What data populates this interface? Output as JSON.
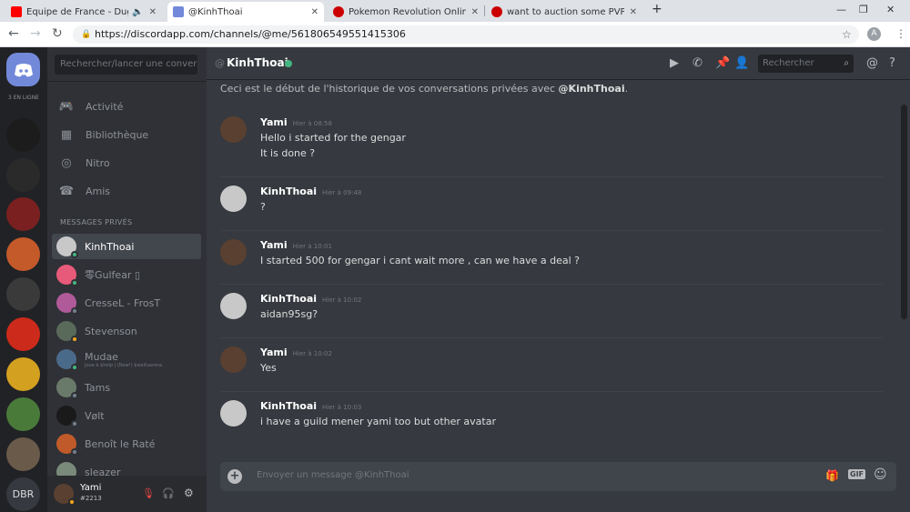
{
  "browser": {
    "tabs": [
      {
        "title": "Equipe de France - Dugarry",
        "fav_color": "#ff0000"
      },
      {
        "title": "@KinhThoai",
        "fav_color": "#7289da"
      },
      {
        "title": "Pokemon Revolution Online",
        "fav_color": "#cc0000"
      },
      {
        "title": "want to auction some PVP POKEM",
        "fav_color": "#cc0000"
      }
    ],
    "url": "https://discordapp.com/channels/@me/561806549551415306",
    "profile_initial": "A"
  },
  "guilds": {
    "online_label": "3 EN LIGNE",
    "bottom_label": "DBR",
    "icon_colors": [
      "#1c1c1c",
      "#2a2a2a",
      "#7a2020",
      "#c45a2a",
      "#3a3a3a",
      "#cc2a1a",
      "#d4a020",
      "#4a7a3a",
      "#6a5a4a"
    ]
  },
  "sidebar": {
    "search_placeholder": "Rechercher/lancer une conversati",
    "nav": [
      {
        "label": "Activité",
        "icon": "gamepad-icon"
      },
      {
        "label": "Bibliothèque",
        "icon": "library-icon"
      },
      {
        "label": "Nitro",
        "icon": "nitro-icon"
      },
      {
        "label": "Amis",
        "icon": "friends-icon"
      }
    ],
    "dm_header": "MESSAGES PRIVÉS",
    "dms": [
      {
        "name": "KinhThoai",
        "sub": "",
        "status": "#43b581",
        "avatar": "#c8c8c8"
      },
      {
        "name": "零Gulfear ▯",
        "sub": "",
        "status": "#43b581",
        "avatar": "#e85a7a"
      },
      {
        "name": "CresseL - FrosT",
        "sub": "",
        "status": "#747f8d",
        "avatar": "#b05a9a"
      },
      {
        "name": "Stevenson",
        "sub": "",
        "status": "#faa61a",
        "avatar": "#5a6a5a"
      },
      {
        "name": "Mudae",
        "sub": "Joue à $help | (New!) $waifuarena",
        "status": "#43b581",
        "avatar": "#4a6a8a"
      },
      {
        "name": "Tams",
        "sub": "",
        "status": "#747f8d",
        "avatar": "#6a7a6a"
      },
      {
        "name": "Vølt",
        "sub": "",
        "status": "#747f8d",
        "avatar": "#1a1a1a"
      },
      {
        "name": "Benoît le Raté",
        "sub": "",
        "status": "#747f8d",
        "avatar": "#c05a2a"
      },
      {
        "name": "sleazer",
        "sub": "",
        "status": "#747f8d",
        "avatar": "#7a8a7a"
      }
    ],
    "user": {
      "name": "Yami",
      "tag": "#2213"
    }
  },
  "chat": {
    "channel": "KinhThoai",
    "header_search": "Rechercher",
    "welcome_prefix": "Ceci est le début de l'historique de vos conversations privées avec ",
    "welcome_user": "@KinhThoai",
    "welcome_suffix": ".",
    "messages": [
      {
        "author": "Yami",
        "time": "Hier à 08:58",
        "lines": [
          "Hello i started for the gengar",
          "It is done ?"
        ],
        "avatar": "#5a4030"
      },
      {
        "author": "KinhThoai",
        "time": "Hier à 09:48",
        "lines": [
          "?"
        ],
        "avatar": "#c8c8c8"
      },
      {
        "author": "Yami",
        "time": "Hier à 10:01",
        "lines": [
          "I started 500 for gengar i cant wait more , can we have a deal ?"
        ],
        "avatar": "#5a4030"
      },
      {
        "author": "KinhThoai",
        "time": "Hier à 10:02",
        "lines": [
          "aidan95sg?"
        ],
        "avatar": "#c8c8c8"
      },
      {
        "author": "Yami",
        "time": "Hier à 10:02",
        "lines": [
          "Yes"
        ],
        "avatar": "#5a4030"
      },
      {
        "author": "KinhThoai",
        "time": "Hier à 10:03",
        "lines": [
          "i have a guild mener yami too but other avatar"
        ],
        "avatar": "#c8c8c8"
      }
    ],
    "composer_placeholder": "Envoyer un message @KinhThoai",
    "gif_label": "GIF"
  }
}
